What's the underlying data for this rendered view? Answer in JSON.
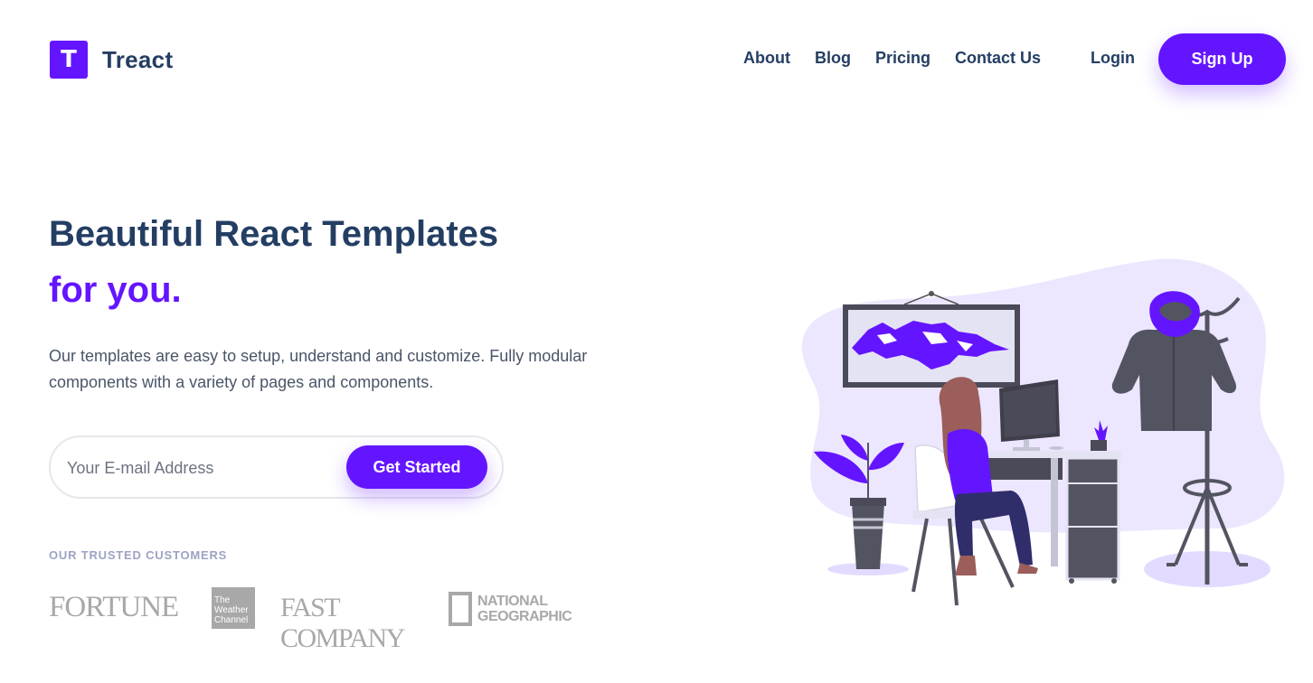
{
  "brand": {
    "logo_letter": "T",
    "name": "Treact"
  },
  "nav": {
    "links": [
      "About",
      "Blog",
      "Pricing",
      "Contact Us"
    ],
    "login": "Login",
    "signup": "Sign Up"
  },
  "hero": {
    "title": "Beautiful React Templates",
    "accent": "for you.",
    "description": "Our templates are easy to setup, understand and customize. Fully modular components with a variety of pages and components.",
    "email_placeholder": "Your E-mail Address",
    "cta": "Get Started"
  },
  "customers": {
    "label": "OUR TRUSTED CUSTOMERS",
    "logos": {
      "fortune": "FORTUNE",
      "weather": [
        "The",
        "Weather",
        "Channel"
      ],
      "fastcompany": "FAST COMPANY",
      "natgeo": [
        "NATIONAL",
        "GEOGRAPHIC"
      ]
    }
  },
  "colors": {
    "primary": "#6415ff",
    "heading": "#243e63",
    "body": "#4a5568",
    "muted": "#9ca3c3",
    "logo_gray": "#a8a8a8"
  }
}
